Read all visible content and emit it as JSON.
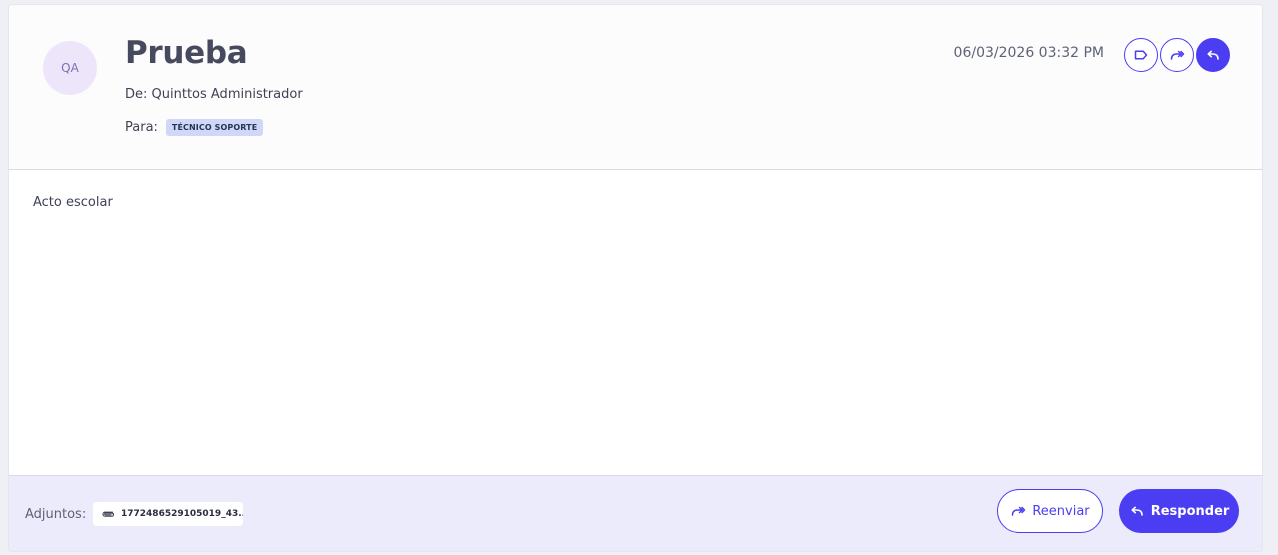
{
  "message": {
    "avatar_initials": "QA",
    "subject": "Prueba",
    "from_text": "De: Quinttos Administrador",
    "to_label": "Para:",
    "recipients": [
      "TÉCNICO SOPORTE"
    ],
    "date": "06/03/2026 03:32 PM",
    "body": "Acto escolar"
  },
  "header_actions": [
    {
      "name": "label-button",
      "icon": "tag-icon"
    },
    {
      "name": "forward-button",
      "icon": "forward-icon"
    },
    {
      "name": "reply-button",
      "icon": "reply-icon"
    }
  ],
  "footer": {
    "attachments_label": "Adjuntos:",
    "attachments": [
      "1772486529105019_43..."
    ],
    "forward_label": "Reenviar",
    "reply_label": "Responder"
  },
  "colors": {
    "accent": "#4b3df2",
    "avatar_bg": "#ede6fb",
    "badge_bg": "#cfd8f6",
    "footer_bg": "#ebebfb"
  }
}
